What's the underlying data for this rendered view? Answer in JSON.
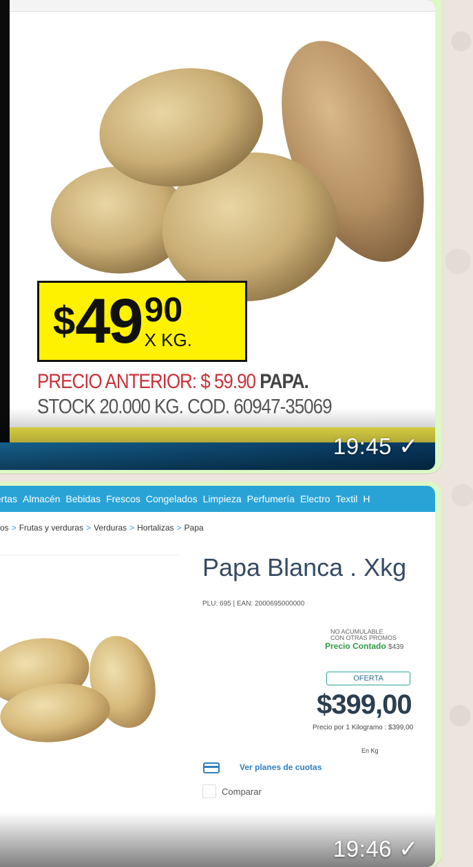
{
  "messages": [
    {
      "time": "19:45",
      "flyer": {
        "price_symbol": "$",
        "price_int": "49",
        "price_cents": "90",
        "price_unit": "X KG.",
        "note_red": "PRECIO ANTERIOR: $ 59.90",
        "note_dark": "PAPA.",
        "note_rest": "STOCK 20.000 KG. COD. 60947-35069"
      }
    },
    {
      "time": "19:46",
      "web": {
        "nav": [
          "fertas",
          "Almacén",
          "Bebidas",
          "Frescos",
          "Congelados",
          "Limpieza",
          "Perfumería",
          "Electro",
          "Textil",
          "H"
        ],
        "breadcrumb": [
          "os",
          "Frutas y verduras",
          "Verduras",
          "Hortalizas",
          "Papa"
        ],
        "breadcrumb_sep": ">",
        "title": "Papa Blanca . Xkg",
        "plu": "PLU: 695 | EAN: 2000695000000",
        "no_acumulable_1": "NO ACUMULABLE",
        "no_acumulable_2": "CON OTRAS PROMOS",
        "contado_label": "Precio Contado",
        "contado_value": "$439",
        "oferta": "OFERTA",
        "price": "$399,00",
        "unit_price": "Precio por 1 Kilogramo : $399,00",
        "en_kg": "En Kg",
        "cuotas": "Ver planes de cuotas",
        "compare": "Comparar"
      }
    }
  ],
  "icons": {
    "check": "✓",
    "card": "credit-card-icon"
  },
  "colors": {
    "bubble": "#dcf8c6",
    "nav": "#29a3d6",
    "tag": "#fff200",
    "contado": "#2e9a43"
  }
}
